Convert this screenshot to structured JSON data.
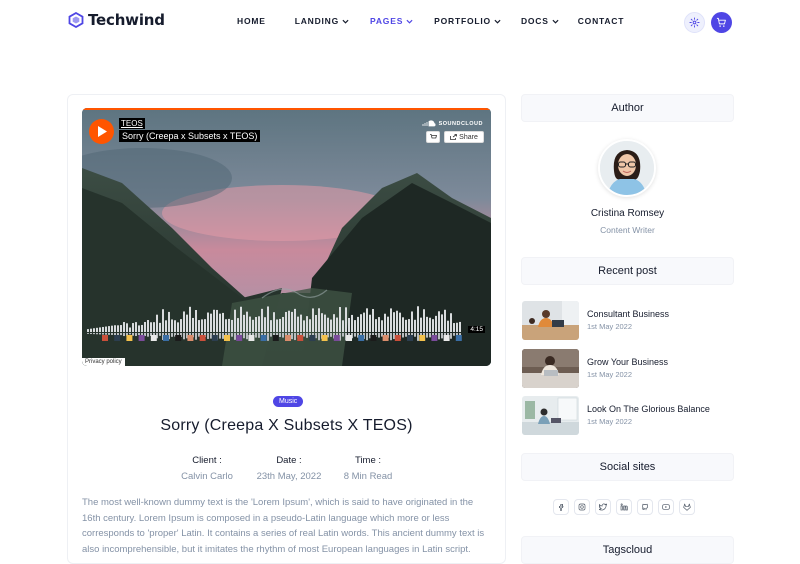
{
  "brand": {
    "name": "Techwind",
    "accent": "#4f46e5"
  },
  "nav": {
    "items": [
      {
        "label": "HOME"
      },
      {
        "label": "LANDING"
      },
      {
        "label": "PAGES"
      },
      {
        "label": "PORTFOLIO"
      },
      {
        "label": "DOCS"
      },
      {
        "label": "CONTACT"
      }
    ],
    "icons": [
      "settings-icon",
      "cart-icon"
    ]
  },
  "player": {
    "artist": "TEOS",
    "track": "Sorry (Creepa x Subsets x TEOS)",
    "service": "SOUNDCLOUD",
    "share_label": "Share",
    "duration": "4:15",
    "privacy_label": "Privacy policy",
    "brand_color": "#ff5500"
  },
  "post": {
    "badge": "Music",
    "title": "Sorry (Creepa X Subsets X TEOS)",
    "meta": [
      {
        "key": "Client :",
        "value": "Calvin Carlo"
      },
      {
        "key": "Date :",
        "value": "23th May, 2022"
      },
      {
        "key": "Time :",
        "value": "8 Min Read"
      }
    ],
    "body": "The most well-known dummy text is the 'Lorem Ipsum', which is said to have originated in the 16th century. Lorem Ipsum is composed in a pseudo-Latin language which more or less corresponds to 'proper' Latin. It contains a series of real Latin words. This ancient dummy text is also incomprehensible, but it imitates the rhythm of most European languages in Latin script."
  },
  "sidebar": {
    "author_heading": "Author",
    "author_name": "Cristina Romsey",
    "author_role": "Content Writer",
    "recent_heading": "Recent post",
    "recent": [
      {
        "title": "Consultant Business",
        "date": "1st May 2022"
      },
      {
        "title": "Grow Your Business",
        "date": "1st May 2022"
      },
      {
        "title": "Look On The Glorious Balance",
        "date": "1st May 2022"
      }
    ],
    "social_heading": "Social sites",
    "social_icons": [
      "facebook-icon",
      "instagram-icon",
      "twitter-icon",
      "linkedin-icon",
      "github-icon",
      "youtube-icon",
      "gitlab-icon"
    ],
    "tags_heading": "Tagscloud"
  }
}
